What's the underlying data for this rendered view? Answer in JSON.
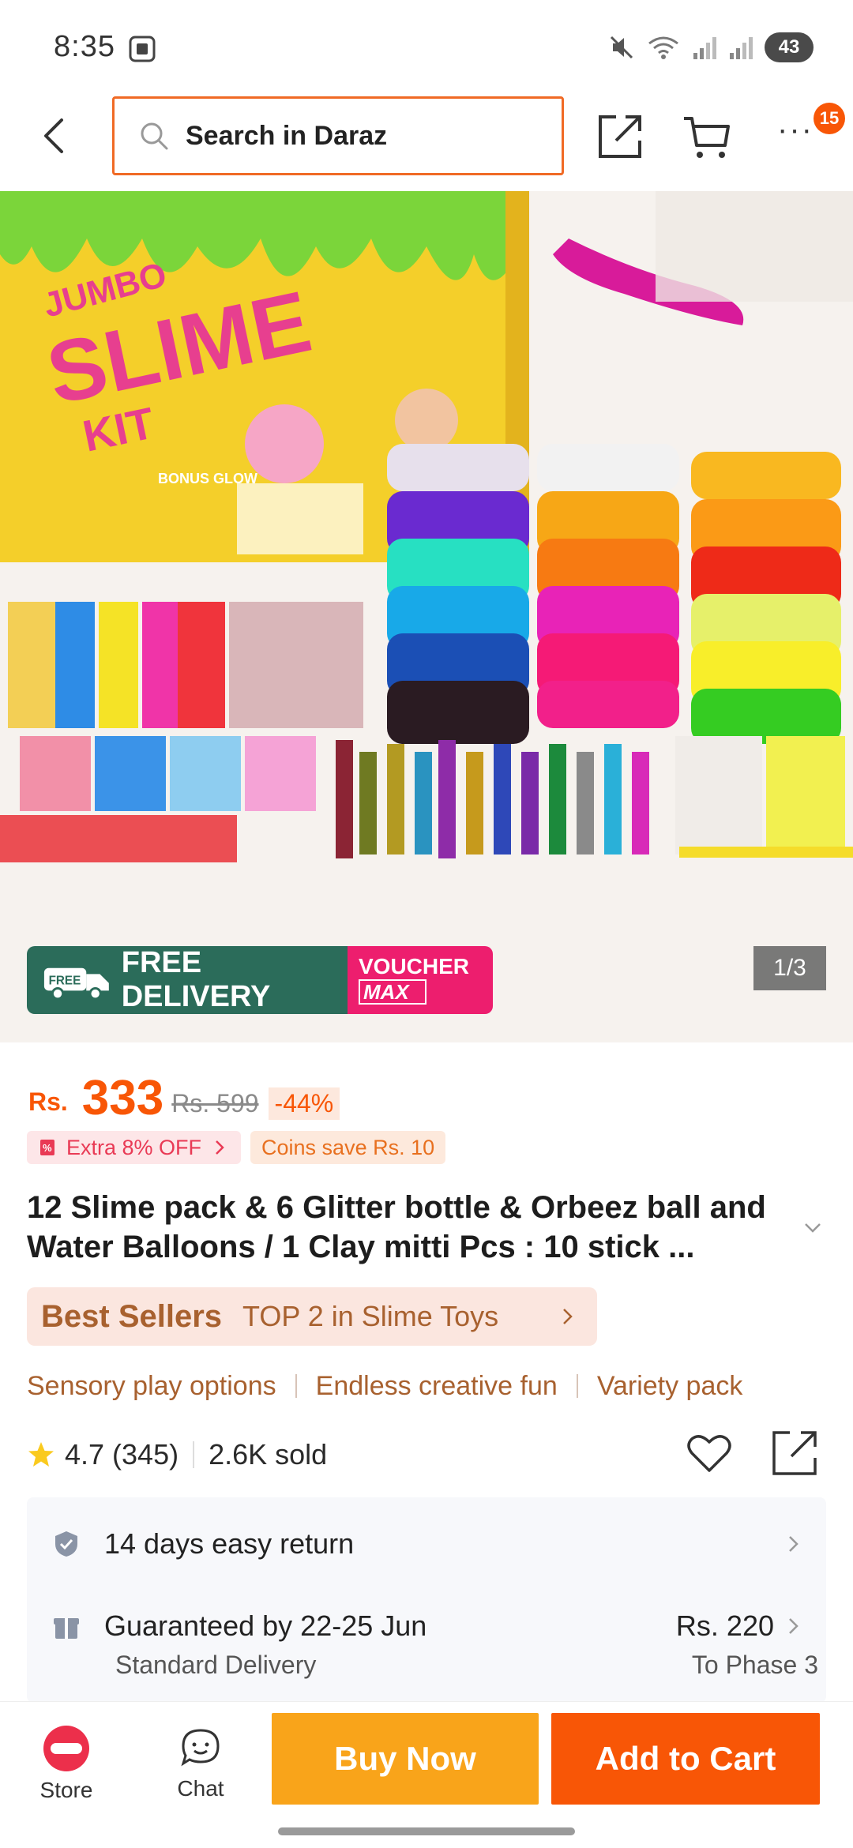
{
  "status_bar": {
    "time": "8:35",
    "battery": "43"
  },
  "header": {
    "search_placeholder": "Search in Daraz",
    "cart_badge": "15"
  },
  "hero": {
    "box_text_1": "JUMBO",
    "box_text_2": "SLIME",
    "box_text_3": "KIT",
    "box_text_4": "BONUS GLOW",
    "free_delivery": "FREE DELIVERY",
    "free_badge": "FREE",
    "voucher_top": "VOUCHER",
    "voucher_bottom": "MAX",
    "counter": "1/3"
  },
  "price": {
    "currency": "Rs.",
    "current": "333",
    "original": "Rs. 599",
    "discount": "-44%"
  },
  "tags": {
    "extra_off": "Extra 8% OFF",
    "coins": "Coins save Rs. 10"
  },
  "product": {
    "title": "12 Slime pack & 6 Glitter bottle & Orbeez ball and Water Balloons / 1 Clay mitti Pcs : 10 stick ..."
  },
  "best_sellers": {
    "label": "Best Sellers",
    "rank_text": "TOP 2 in Slime Toys"
  },
  "features": [
    "Sensory play options",
    "Endless creative fun",
    "Variety pack"
  ],
  "rating": {
    "score": "4.7",
    "count": "(345)",
    "sold": "2.6K sold"
  },
  "service": {
    "return_policy": "14 days easy return",
    "delivery_guarantee": "Guaranteed by 22-25 Jun",
    "delivery_fee": "Rs. 220",
    "delivery_type": "Standard Delivery",
    "delivery_to": "To Phase 3"
  },
  "bottom_bar": {
    "store_label": "Store",
    "chat_label": "Chat",
    "buy_now": "Buy Now",
    "add_to_cart": "Add to Cart"
  },
  "colors": {
    "accent": "#f85606",
    "buy_now": "#f9a41a",
    "search_border": "#f06a25",
    "best_seller_text": "#a8612f"
  }
}
